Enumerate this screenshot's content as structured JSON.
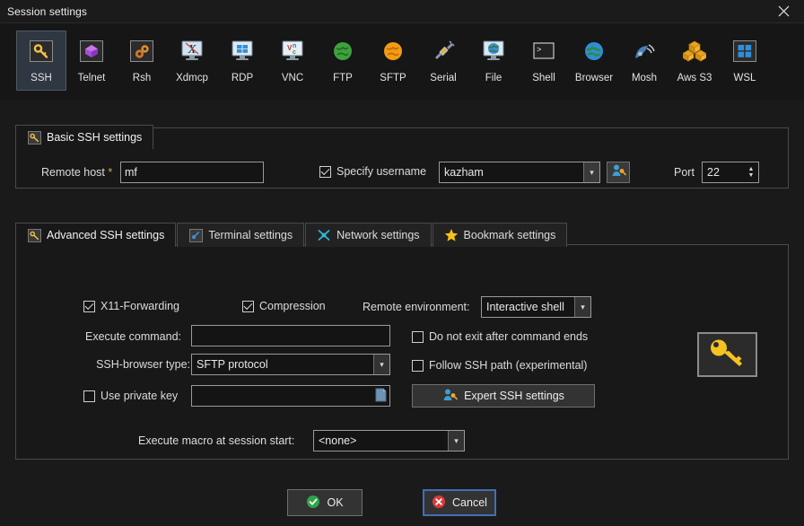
{
  "window": {
    "title": "Session settings",
    "close_label": "×"
  },
  "protocols": [
    {
      "label": "SSH",
      "icon": "key-icon",
      "selected": true
    },
    {
      "label": "Telnet",
      "icon": "gem-icon",
      "selected": false
    },
    {
      "label": "Rsh",
      "icon": "gears-icon",
      "selected": false
    },
    {
      "label": "Xdmcp",
      "icon": "xmonitor-icon",
      "selected": false
    },
    {
      "label": "RDP",
      "icon": "windows-monitor-icon",
      "selected": false
    },
    {
      "label": "VNC",
      "icon": "vnc-monitor-icon",
      "selected": false
    },
    {
      "label": "FTP",
      "icon": "green-globe-icon",
      "selected": false
    },
    {
      "label": "SFTP",
      "icon": "orange-globe-icon",
      "selected": false
    },
    {
      "label": "Serial",
      "icon": "serial-plug-icon",
      "selected": false
    },
    {
      "label": "File",
      "icon": "globe-monitor-icon",
      "selected": false
    },
    {
      "label": "Shell",
      "icon": "terminal-prompt-icon",
      "selected": false
    },
    {
      "label": "Browser",
      "icon": "blue-globe-icon",
      "selected": false
    },
    {
      "label": "Mosh",
      "icon": "satellite-dish-icon",
      "selected": false
    },
    {
      "label": "Aws S3",
      "icon": "aws-cubes-icon",
      "selected": false
    },
    {
      "label": "WSL",
      "icon": "windows-logo-icon",
      "selected": false
    }
  ],
  "basic": {
    "tab_label": "Basic SSH settings",
    "tab_icon": "key-icon",
    "remote_host_label": "Remote host",
    "remote_host_required": "*",
    "remote_host_value": "mf",
    "specify_username_label": "Specify username",
    "specify_username_checked": true,
    "username_value": "kazham",
    "user_button_icon": "user-key-icon",
    "port_label": "Port",
    "port_value": "22"
  },
  "advanced": {
    "tabs": [
      {
        "label": "Advanced SSH settings",
        "icon": "key-icon",
        "active": true
      },
      {
        "label": "Terminal settings",
        "icon": "terminal-icon",
        "active": false
      },
      {
        "label": "Network settings",
        "icon": "network-icon",
        "active": false
      },
      {
        "label": "Bookmark settings",
        "icon": "star-icon",
        "active": false
      }
    ],
    "x11_forwarding_label": "X11-Forwarding",
    "x11_forwarding_checked": true,
    "compression_label": "Compression",
    "compression_checked": true,
    "remote_env_label": "Remote environment:",
    "remote_env_value": "Interactive shell",
    "execute_command_label": "Execute command:",
    "execute_command_value": "",
    "do_not_exit_label": "Do not exit after command ends",
    "do_not_exit_checked": false,
    "ssh_browser_label": "SSH-browser type:",
    "ssh_browser_value": "SFTP protocol",
    "follow_ssh_path_label": "Follow SSH path (experimental)",
    "follow_ssh_path_checked": false,
    "use_private_key_label": "Use private key",
    "use_private_key_checked": false,
    "private_key_value": "",
    "private_key_browse_icon": "file-icon",
    "expert_button_label": "Expert SSH settings",
    "expert_button_icon": "user-key-icon",
    "macro_label": "Execute macro at session start:",
    "macro_value": "<none>",
    "side_key_icon": "key-icon"
  },
  "footer": {
    "ok_label": "OK",
    "ok_icon": "green-check-icon",
    "cancel_label": "Cancel",
    "cancel_icon": "red-x-icon"
  },
  "colors": {
    "accent_gold": "#f5c242",
    "accent_blue": "#3f6fb5",
    "ok_green": "#2fa34a",
    "cancel_red": "#d93a3a",
    "panel_bg": "#181818",
    "window_bg": "#1a1a1a"
  }
}
